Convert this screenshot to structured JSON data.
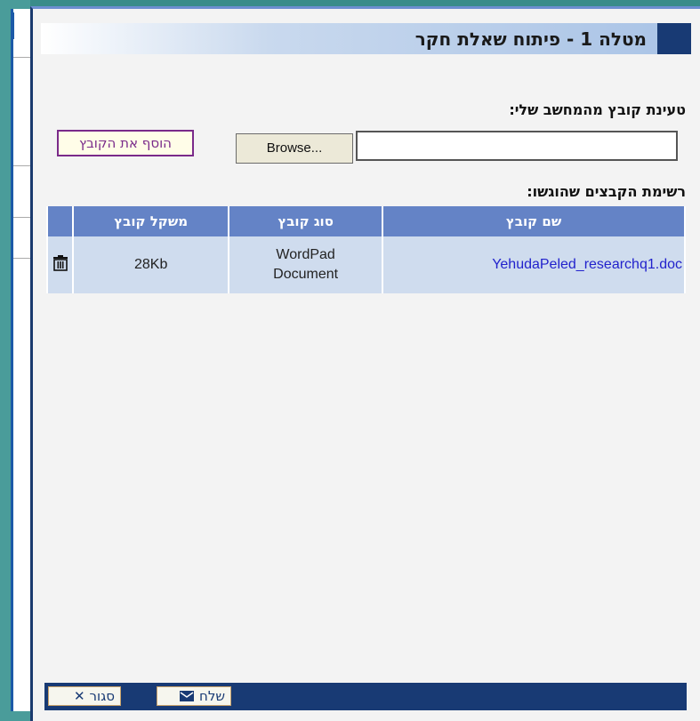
{
  "dialog": {
    "title": "מטלה 1 - פיתוח שאלת חקר"
  },
  "upload": {
    "section_label": "טעינת קובץ מהמחשב שלי:",
    "file_input_value": "",
    "browse_label": "Browse...",
    "add_file_label": "הוסף את הקובץ"
  },
  "files": {
    "section_label": "רשימת הקבצים שהוגשו:",
    "columns": [
      "שם קובץ",
      "סוג קובץ",
      "משקל קובץ"
    ],
    "rows": [
      {
        "name": "YehudaPeled_researchq1.doc",
        "type": "WordPad Document",
        "size": "28Kb",
        "action_icon": "trash-icon"
      }
    ]
  },
  "footer": {
    "send_label": "שלח",
    "send_icon": "envelope-icon",
    "close_label": "סגור",
    "close_icon": "close-icon"
  },
  "colors": {
    "header_accent": "#183a74",
    "table_header": "#6483c6",
    "table_row": "#cfdcee",
    "link": "#2222cc",
    "add_button_border": "#7a2a8a",
    "background": "#3a8c8a"
  }
}
